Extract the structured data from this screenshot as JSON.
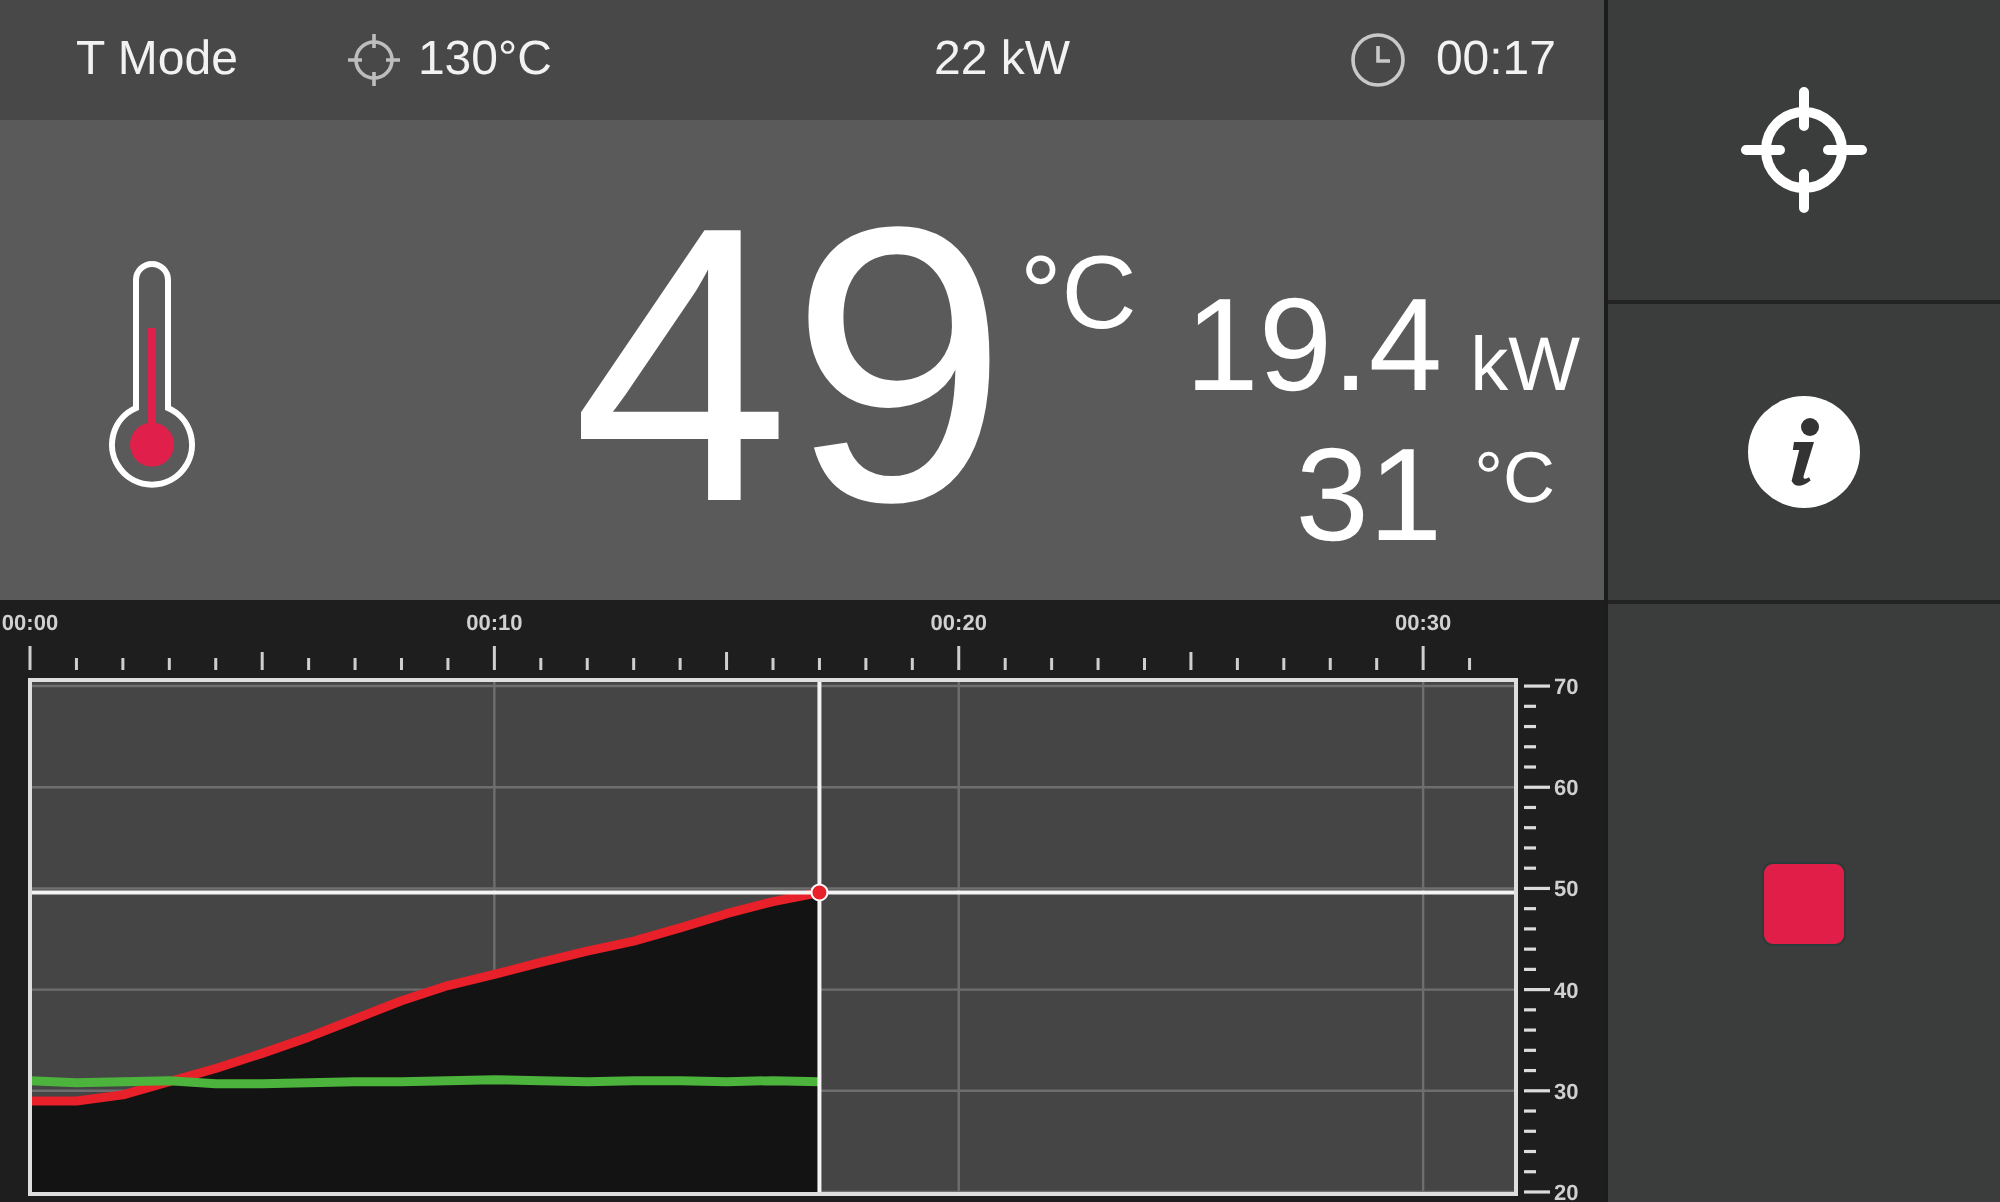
{
  "status_bar": {
    "mode": "T Mode",
    "setpoint": "130°C",
    "power": "22 kW",
    "time": "00:17"
  },
  "main_reading": {
    "value": "49",
    "unit": "°C"
  },
  "secondary_readings": [
    {
      "kind": "power",
      "value": "19.4",
      "unit": "kW"
    },
    {
      "kind": "temperature",
      "value": "31",
      "unit": "°C"
    }
  ],
  "chart": {
    "chart_data": {
      "type": "line",
      "x": [
        0,
        1,
        2,
        3,
        4,
        5,
        6,
        7,
        8,
        9,
        10,
        11,
        12,
        13,
        14,
        15,
        16,
        17
      ],
      "xlim": [
        0,
        32
      ],
      "ylim": [
        19.8,
        70.6
      ],
      "xticks": [
        {
          "value": 0,
          "label": "00:00"
        },
        {
          "value": 10,
          "label": "00:10"
        },
        {
          "value": 20,
          "label": "00:20"
        },
        {
          "value": 30,
          "label": "00:30"
        }
      ],
      "yticks": [
        20,
        30,
        40,
        50,
        60,
        70
      ],
      "grid": true,
      "ref_lines": [
        {
          "axis": "x",
          "value": 17
        },
        {
          "axis": "y",
          "value": 49.6
        }
      ],
      "series": [
        {
          "type": "area",
          "color": "#e8202a",
          "values": [
            29,
            29,
            29.6,
            30.9,
            32.2,
            33.7,
            35.3,
            37.1,
            38.9,
            40.4,
            41.5,
            42.7,
            43.8,
            44.8,
            46.1,
            47.5,
            48.7,
            49.6
          ]
        },
        {
          "type": "line",
          "color": "#4cb33c",
          "values": [
            31,
            30.8,
            30.9,
            31,
            30.7,
            30.7,
            30.8,
            30.9,
            30.9,
            31,
            31.1,
            31,
            30.9,
            31,
            31,
            30.9,
            31,
            30.9
          ]
        }
      ]
    }
  },
  "sidebar": {
    "buttons": [
      {
        "kind": "target"
      },
      {
        "kind": "info"
      },
      {
        "kind": "stop"
      }
    ]
  }
}
